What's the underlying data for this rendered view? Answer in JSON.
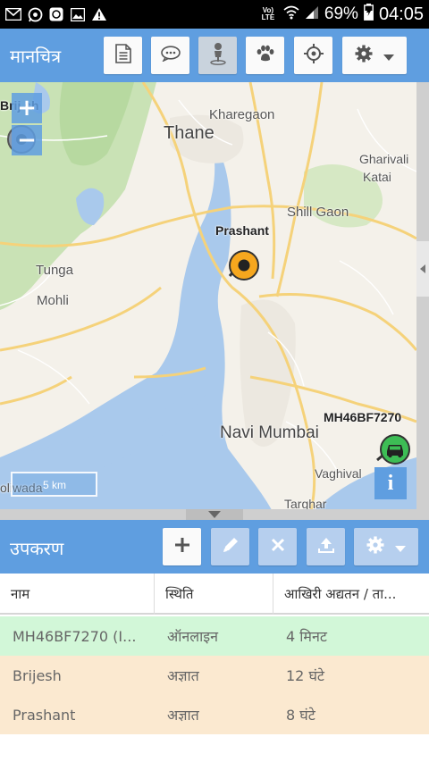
{
  "status_bar": {
    "icons": [
      "gmail-icon",
      "whatsapp-icon",
      "app-icon",
      "image-icon",
      "warning-icon"
    ],
    "network_label": "Vo) LTE",
    "battery_percent": "69%",
    "time": "04:05"
  },
  "map_toolbar": {
    "title": "मानचित्र",
    "buttons": [
      "report-icon",
      "chat-icon",
      "person-pin-icon",
      "paw-icon",
      "crosshair-icon",
      "gear-icon"
    ]
  },
  "map": {
    "labels": {
      "kharegaon": "Kharegaon",
      "thane": "Thane",
      "gharivali": "Gharivali",
      "katai": "Katai",
      "shill_gaon": "Shill Gaon",
      "tunga": "Tunga",
      "mohli": "Mohli",
      "navi_mumbai": "Navi Mumbai",
      "vaghivali": "Vaghival",
      "targhar": "Targhar",
      "oliwada": "oliwada",
      "brijesh_partial": "Brij   sh"
    },
    "markers": {
      "prashant": "Prashant",
      "vehicle": "MH46BF7270"
    },
    "zoom_in": "+",
    "zoom_out": "−",
    "scale": "5 km",
    "info": "i"
  },
  "devices_toolbar": {
    "title": "उपकरण",
    "buttons": [
      "add-icon",
      "edit-icon",
      "remove-icon",
      "upload-icon",
      "gear-icon"
    ]
  },
  "table": {
    "columns": [
      "नाम",
      "स्थिति",
      "आखिरी अद्यतन / ता..."
    ],
    "rows": [
      {
        "name": "MH46BF7270 (I...",
        "status": "ऑनलाइन",
        "updated": "4 मिनट",
        "color": "#d2f7d8"
      },
      {
        "name": "Brijesh",
        "status": "अज्ञात",
        "updated": "12 घंटे",
        "color": "#fbe9d0"
      },
      {
        "name": "Prashant",
        "status": "अज्ञात",
        "updated": "8 घंटे",
        "color": "#fbe9d0"
      }
    ]
  },
  "colors": {
    "accent": "#5f9ee0",
    "online_row": "#d2f7d8",
    "unknown_row": "#fbe9d0"
  }
}
